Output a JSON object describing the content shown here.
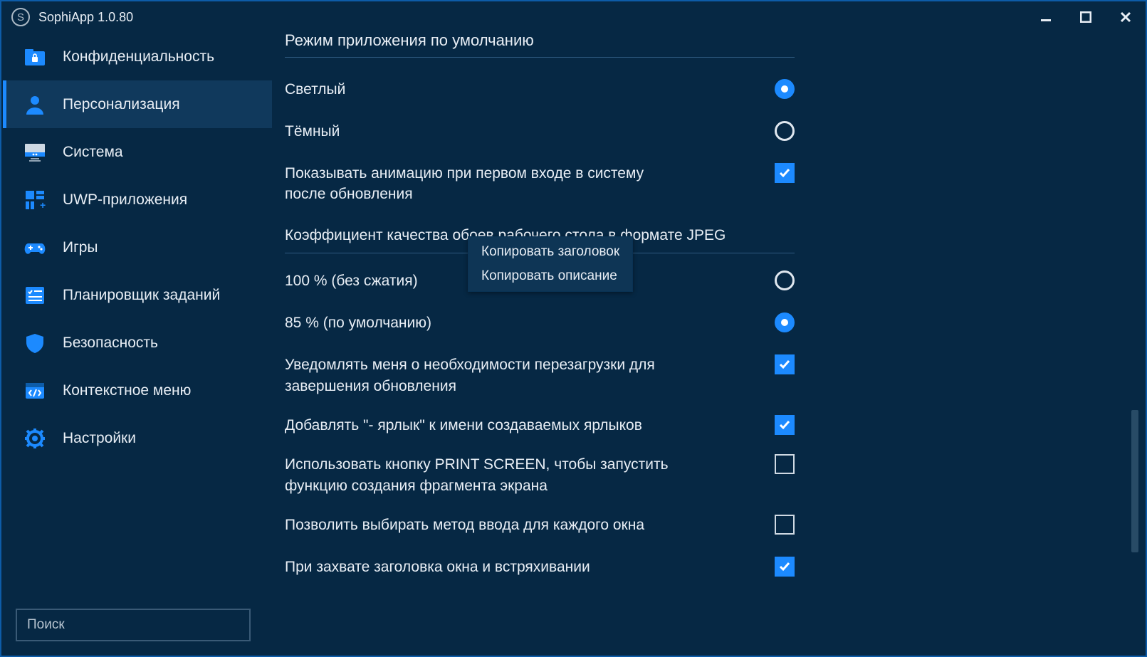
{
  "app": {
    "title": "SophiApp 1.0.80"
  },
  "sidebar": {
    "items": [
      {
        "label": "Конфиденциальность"
      },
      {
        "label": "Персонализация"
      },
      {
        "label": "Система"
      },
      {
        "label": "UWP-приложения"
      },
      {
        "label": "Игры"
      },
      {
        "label": "Планировщик заданий"
      },
      {
        "label": "Безопасность"
      },
      {
        "label": "Контекстное меню"
      },
      {
        "label": "Настройки"
      }
    ],
    "search_placeholder": "Поиск"
  },
  "content": {
    "section1_header": "Режим приложения по умолчанию",
    "theme_light": "Светлый",
    "theme_dark": "Тёмный",
    "anim_first_signin": "Показывать анимацию при первом входе в систему после обновления",
    "jpeg_quality_header": "Коэффициент качества обоев рабочего стола в формате JPEG",
    "q100": "100 % (без сжатия)",
    "q85": "85 % (по умолчанию)",
    "notify_restart": "Уведомлять меня о необходимости перезагрузки для завершения обновления",
    "shortcut_suffix": "Добавлять \"- ярлык\" к имени создаваемых ярлыков",
    "printscreen_snip": "Использовать кнопку PRINT SCREEN, чтобы запустить функцию создания фрагмента экрана",
    "input_per_window": "Позволить выбирать метод ввода для каждого окна",
    "aero_shake": "При захвате заголовка окна и встряхивании"
  },
  "context_menu": {
    "copy_title": "Копировать заголовок",
    "copy_desc": "Копировать описание"
  }
}
